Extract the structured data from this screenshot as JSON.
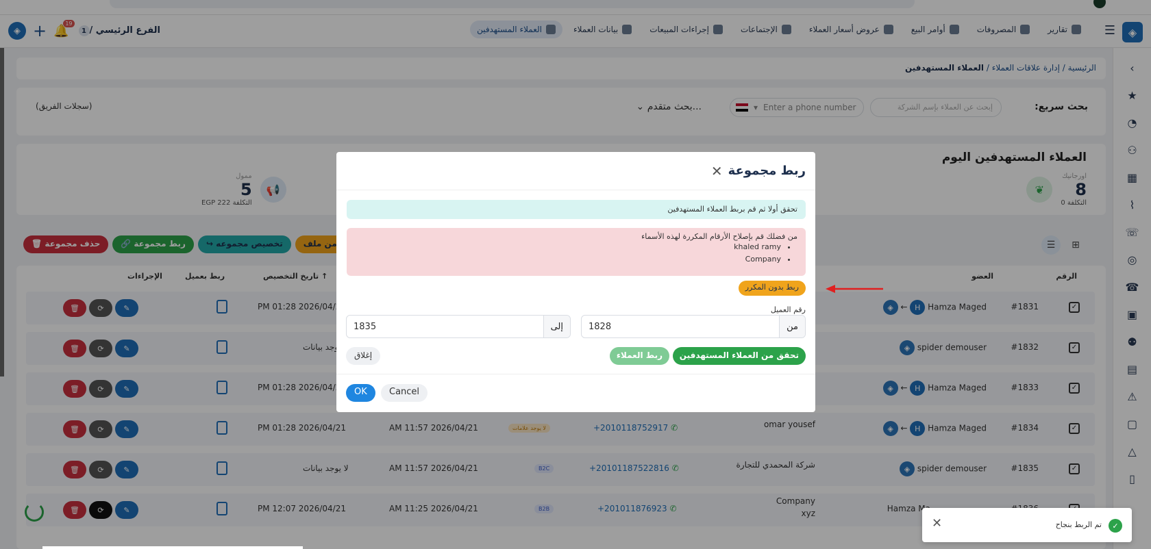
{
  "nav": {
    "items": [
      {
        "label": "العملاء المستهدفين",
        "active": true
      },
      {
        "label": "بيانات العملاء"
      },
      {
        "label": "إجراءات المبيعات"
      },
      {
        "label": "الإجتماعات"
      },
      {
        "label": "عروض أسعار العملاء"
      },
      {
        "label": "أوامر البيع"
      },
      {
        "label": "المصروفات"
      },
      {
        "label": "تقارير"
      }
    ],
    "branch": "الفرع الرئيسي /",
    "branch_num": "1",
    "notif_count": "19"
  },
  "breadcrumb": {
    "home": "الرئيسية",
    "sep": "/",
    "crm": "إدارة علاقات العملاء",
    "current": "العملاء المستهدفين"
  },
  "search": {
    "label": "بحث سريع:",
    "name_placeholder": "إبحث عن العملاء بإسم الشركة",
    "phone_placeholder": "Enter a phone number",
    "advanced": "بحث متقدم...",
    "team_records": "(سجلات الفريق)"
  },
  "stats": {
    "title": "العملاء المستهدفين اليوم",
    "organic": {
      "label": "اورجانيك",
      "value": "8",
      "cost": "التكلفة 0"
    },
    "funded": {
      "label": "ممول",
      "value": "5",
      "cost": "التكلفة 222 EGP"
    }
  },
  "actions": {
    "delete_group": "🗑 حذف مجموعة",
    "link_group": "🔗 ربط مجموعة",
    "assign_group": "↪ تخصيص مجموعه",
    "import_file": "إستيراد من ملف"
  },
  "table": {
    "headers": {
      "num": "الرقم",
      "member": "العضو",
      "assign_date": "تاريخ التخصيص ↑",
      "link_client": "ربط بعميل",
      "actions": "الإجراءات"
    },
    "rows": [
      {
        "num": "#1831",
        "member": "Hamza Maged",
        "client": "",
        "phone": "",
        "tag": "",
        "created": "",
        "assigned": "PM 01:28 2026/04/21"
      },
      {
        "num": "#1832",
        "member": "spider demouser",
        "client": "",
        "phone": "",
        "tag": "",
        "created": "",
        "assigned": "لا يوجد بيانات"
      },
      {
        "num": "#1833",
        "member": "Hamza Maged",
        "client": "",
        "phone": "",
        "tag": "",
        "created": "",
        "assigned": "PM 01:28 2026/04/21"
      },
      {
        "num": "#1834",
        "member": "Hamza Maged",
        "client": "omar yousef",
        "phone": "+2010118752917",
        "tag": "لا يوجد علامات",
        "created": "AM 11:57 2026/04/21",
        "assigned": "PM 01:28 2026/04/21"
      },
      {
        "num": "#1835",
        "member": "spider demouser",
        "client": "شركة المحمدي للتجارة",
        "phone": "+20101187522816",
        "tag": "B2C",
        "created": "AM 11:57 2026/04/21",
        "assigned": "لا يوجد بيانات"
      },
      {
        "num": "#1836",
        "member": "Hamza Ma",
        "client": "Company",
        "client2": "xyz",
        "phone": "+201011876923",
        "tag": "B2B",
        "created": "AM 11:25 2026/04/21",
        "assigned": "PM 12:07 2026/04/21"
      }
    ]
  },
  "modal": {
    "title": "ربط مجموعة",
    "info": "تحقق أولا ثم قم بربط العملاء المستهدفين",
    "danger": "من فضلك قم بإصلاح الأرقام المكررة لهذه الأسماء",
    "duplicates": [
      "khaled ramy",
      "Company"
    ],
    "link_no_dup": "ربط بدون المكرر",
    "client_num_label": "رقم العميل",
    "from_label": "من",
    "from_value": "1828",
    "to_label": "إلى",
    "to_value": "1835",
    "check_btn": "تحقق من العملاء المستهدفين",
    "link_btn": "ربط العملاء",
    "close_btn": "إغلاق",
    "ok": "OK",
    "cancel": "Cancel"
  },
  "toast": {
    "message": "تم الربط بنجاح"
  },
  "colors": {
    "primary": "#1f6fb8",
    "success": "#2ca24a",
    "danger": "#c9303e",
    "teal": "#23a8a8",
    "warning": "#f0a41c"
  }
}
